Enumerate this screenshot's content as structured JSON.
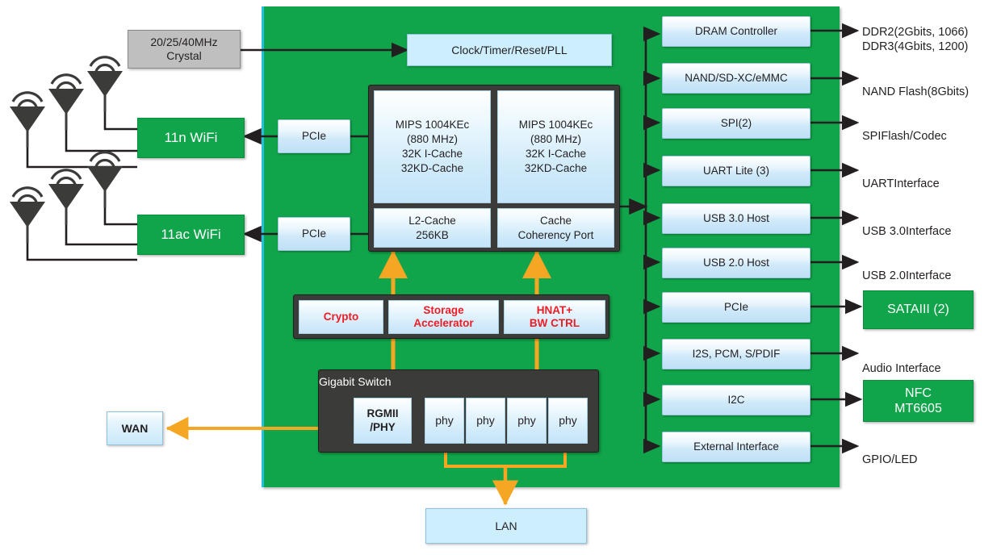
{
  "diagram": {
    "title": "SoC Block Diagram",
    "colors": {
      "die_green": "#10a54a",
      "block_blue": "#cdeefd",
      "accent_orange": "#f5a623",
      "red_text": "#ee1c25",
      "dark_container": "#3b3b39",
      "crystal_gray": "#bfbfbf"
    }
  },
  "external_left": {
    "crystal": {
      "label": "20/25/40MHz\nCrystal"
    },
    "wifi": [
      {
        "label": "11n WiFi",
        "antennas": 3
      },
      {
        "label": "11ac WiFi",
        "antennas": 3
      }
    ],
    "wan": {
      "label": "WAN"
    }
  },
  "external_bottom": {
    "lan": {
      "label": "LAN"
    }
  },
  "clock_block": {
    "label": "Clock/Timer/Reset/PLL"
  },
  "pcie_bridges": [
    {
      "label": "PCIe"
    },
    {
      "label": "PCIe"
    }
  ],
  "cpu_complex": {
    "cores": [
      {
        "lines": [
          "MIPS 1004KEc",
          "(880 MHz)",
          "32K I-Cache",
          "32KD-Cache"
        ]
      },
      {
        "lines": [
          "MIPS 1004KEc",
          "(880 MHz)",
          "32K I-Cache",
          "32KD-Cache"
        ]
      }
    ],
    "caches": [
      {
        "lines": [
          "L2-Cache",
          "256KB"
        ]
      },
      {
        "lines": [
          "Cache",
          "Coherency Port"
        ]
      }
    ]
  },
  "accelerators": [
    {
      "lines": [
        "Crypto"
      ]
    },
    {
      "lines": [
        "Storage",
        "Accelerator"
      ]
    },
    {
      "lines": [
        "HNAT+",
        "BW CTRL"
      ]
    }
  ],
  "gigabit_switch": {
    "title": "Gigabit Switch",
    "rgmii": {
      "lines": [
        "RGMII",
        "/PHY"
      ]
    },
    "phys": [
      {
        "label": "phy"
      },
      {
        "label": "phy"
      },
      {
        "label": "phy"
      },
      {
        "label": "phy"
      }
    ]
  },
  "peripherals": [
    {
      "block": "DRAM Controller",
      "external": {
        "type": "text",
        "label": "DDR2(2Gbits,  1066)\nDDR3(4Gbits,  1200)"
      }
    },
    {
      "block": "NAND/SD-XC/eMMC",
      "external": {
        "type": "text",
        "label": "NAND  Flash(8Gbits)"
      }
    },
    {
      "block": "SPI(2)",
      "external": {
        "type": "text",
        "label": "SPIFlash/Codec"
      }
    },
    {
      "block": "UART Lite (3)",
      "external": {
        "type": "text",
        "label": "UARTInterface"
      }
    },
    {
      "block": "USB 3.0 Host",
      "external": {
        "type": "text",
        "label": "USB 3.0Interface"
      }
    },
    {
      "block": "USB 2.0 Host",
      "external": {
        "type": "text",
        "label": "USB 2.0Interface"
      }
    },
    {
      "block": "PCIe",
      "external": {
        "type": "green",
        "label": "SATAIII (2)"
      }
    },
    {
      "block": "I2S, PCM, S/PDIF",
      "external": {
        "type": "text",
        "label": "Audio Interface"
      }
    },
    {
      "block": "I2C",
      "external": {
        "type": "green",
        "label": "NFC\nMT6605"
      }
    },
    {
      "block": "External Interface",
      "external": {
        "type": "text",
        "label": "GPIO/LED"
      }
    }
  ]
}
